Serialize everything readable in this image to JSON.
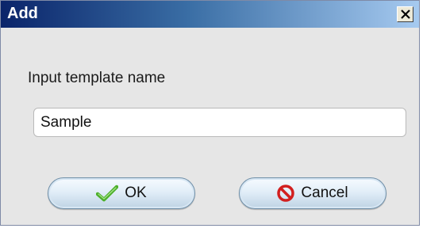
{
  "dialog": {
    "title": "Add",
    "close_icon": "close-icon",
    "prompt": "Input template name",
    "name_field": {
      "value": "Sample",
      "placeholder": ""
    },
    "ok_button": {
      "label": "OK",
      "icon": "check-icon"
    },
    "cancel_button": {
      "label": "Cancel",
      "icon": "no-entry-icon"
    }
  },
  "colors": {
    "titlebar_start": "#0a246a",
    "titlebar_end": "#a6caf0",
    "dialog_bg": "#e6e6e6",
    "ok_icon": "#4caf2a",
    "cancel_icon": "#d21f1f"
  }
}
